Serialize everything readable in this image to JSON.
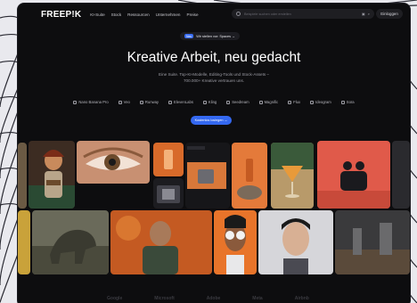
{
  "nav": {
    "logo": "FREEP!K",
    "links": [
      "KI-Suite",
      "Stock",
      "Ressourcen",
      "Unternehmen",
      "Preise"
    ],
    "search_placeholder": "Beispiele suchen oder erstellen",
    "login": "Einloggen"
  },
  "hero": {
    "badge_new": "Neu",
    "badge_text": "Wir stellen vor: Spaces  →",
    "headline": "Kreative Arbeit, neu gedacht",
    "sub_line1": "Eine Suite. Top-KI-Modelle, Editing-Tools und Stock-Assets –",
    "sub_line2": "700.000+ Kreative vertrauen uns.",
    "features": [
      "Nano Banana Pro",
      "Veo",
      "Runway",
      "ElevenLabs",
      "Kling",
      "Seedream",
      "Magnific",
      "Flux",
      "Ideogram",
      "Sora"
    ],
    "cta": "Kostenlos loslegen  →"
  },
  "colors": {
    "accent": "#3468f0",
    "background": "#0d0d0f"
  },
  "footer": {
    "logos": [
      "Google",
      "Microsoft",
      "Adobe",
      "Meta",
      "Airbnb"
    ]
  }
}
